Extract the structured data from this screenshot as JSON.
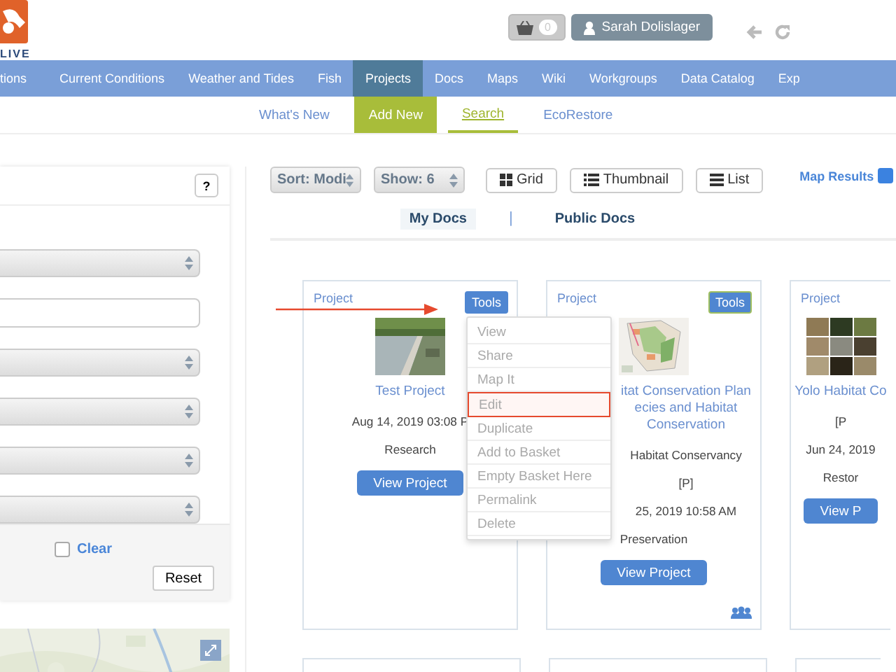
{
  "header": {
    "logo_text": "LIVE",
    "cart_count": "0",
    "user": "Sarah Dolislager"
  },
  "nav": [
    {
      "label": "tions",
      "selected": false
    },
    {
      "label": "Current Conditions",
      "selected": false
    },
    {
      "label": "Weather and Tides",
      "selected": false
    },
    {
      "label": "Fish",
      "selected": false
    },
    {
      "label": "Projects",
      "selected": true
    },
    {
      "label": "Docs",
      "selected": false
    },
    {
      "label": "Maps",
      "selected": false
    },
    {
      "label": "Wiki",
      "selected": false
    },
    {
      "label": "Workgroups",
      "selected": false
    },
    {
      "label": "Data Catalog",
      "selected": false
    },
    {
      "label": "Exp",
      "selected": false
    }
  ],
  "subnav": [
    {
      "label": "What's New",
      "kind": "link",
      "selected": false
    },
    {
      "label": "Add New",
      "kind": "action",
      "selected": false
    },
    {
      "label": "Search",
      "kind": "link",
      "selected": true
    },
    {
      "label": "EcoRestore",
      "kind": "link",
      "selected": false
    }
  ],
  "filters": {
    "help": "?",
    "fields": [
      {
        "kind": "select"
      },
      {
        "kind": "input"
      },
      {
        "kind": "select"
      },
      {
        "kind": "select"
      },
      {
        "kind": "select"
      },
      {
        "kind": "select"
      }
    ],
    "clear": {
      "label": "Clear",
      "checked": false
    },
    "reset": "Reset"
  },
  "toolbar": {
    "sort": "Sort: Modi",
    "show": "Show: 6",
    "views": [
      {
        "label": "Grid",
        "kind": "grid"
      },
      {
        "label": "Thumbnail",
        "kind": "thumbnail"
      },
      {
        "label": "List",
        "kind": "list"
      }
    ],
    "map_results": {
      "label": "Map Results",
      "checked": true
    }
  },
  "doc_tabs": {
    "separator": "|",
    "tabs": [
      {
        "label": "My Docs",
        "selected": true
      },
      {
        "label": "Public Docs",
        "selected": false
      }
    ]
  },
  "cards": [
    {
      "type_label": "Project",
      "tools": {
        "label": "Tools",
        "open": true
      },
      "title_lines": [
        "Test Project"
      ],
      "details": [
        "Aug 14, 2019 03:08 P",
        "Research"
      ],
      "button": "View Project",
      "group": false,
      "covered": false
    },
    {
      "type_label": "Project",
      "tools": {
        "label": "Tools",
        "open": false
      },
      "title_lines": [
        "itat Conservation Plan",
        "ecies and Habitat",
        "Conservation"
      ],
      "details": [
        "Habitat Conservancy",
        "[P]",
        "25, 2019 10:58 AM"
      ],
      "details_below": [
        "Preservation"
      ],
      "button": "View Project",
      "group": true,
      "covered": true
    },
    {
      "type_label": "Project",
      "title_lines": [
        "Yolo Habitat Co"
      ],
      "details": [
        "[P",
        "Jun 24, 2019",
        "Restor"
      ],
      "button": "View P",
      "group": false,
      "covered": false
    }
  ],
  "tools_menu": [
    {
      "label": "View",
      "highlighted": false
    },
    {
      "label": "Share",
      "highlighted": false
    },
    {
      "label": "Map It",
      "highlighted": false
    },
    {
      "label": "Edit",
      "highlighted": true
    },
    {
      "label": "Duplicate",
      "highlighted": false
    },
    {
      "label": "Add to Basket",
      "highlighted": false
    },
    {
      "label": "Empty Basket Here",
      "highlighted": false
    },
    {
      "label": "Permalink",
      "highlighted": false
    },
    {
      "label": "Delete",
      "highlighted": false
    }
  ]
}
